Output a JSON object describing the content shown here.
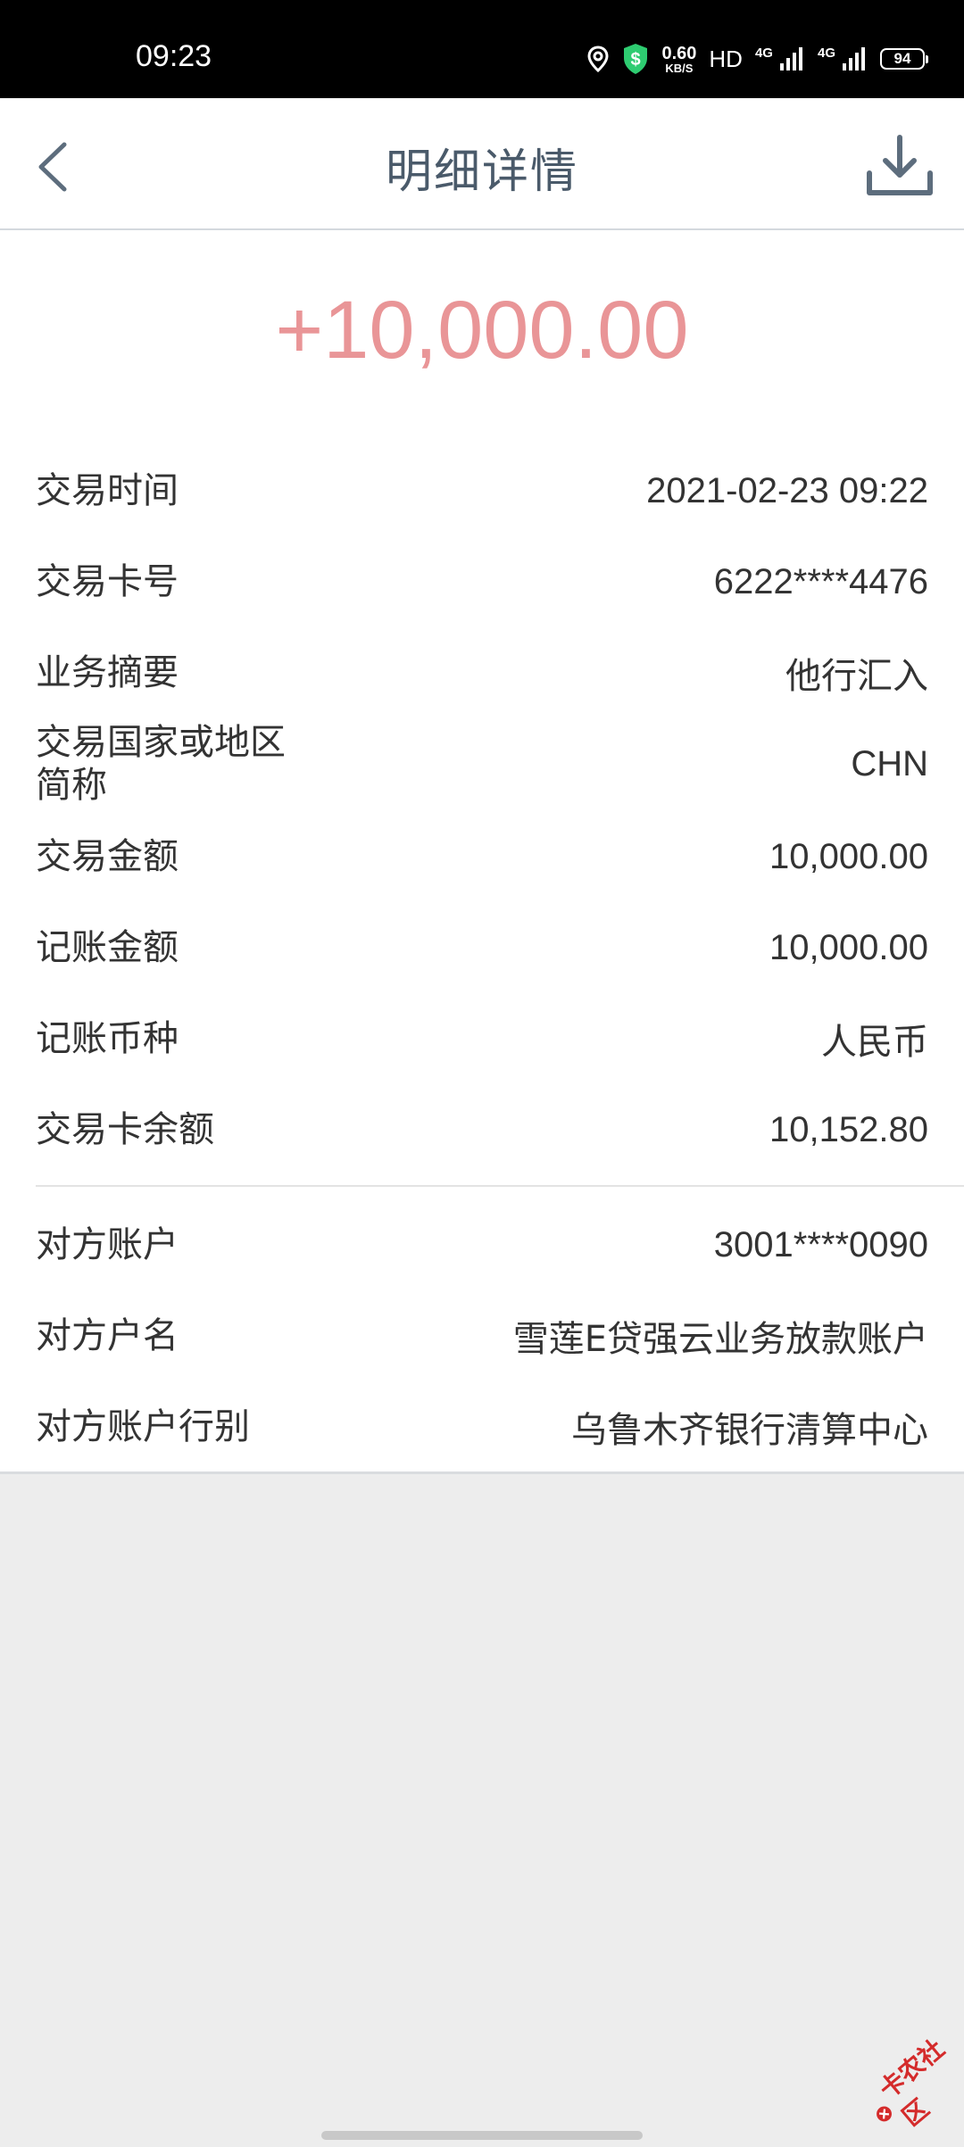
{
  "status_bar": {
    "time": "09:23",
    "net_speed": "0.60",
    "net_speed_unit": "KB/S",
    "hd_label": "HD",
    "signal1_label": "4G",
    "signal2_label": "4G",
    "battery": "94"
  },
  "header": {
    "title": "明细详情",
    "back_icon": "chevron-left-icon",
    "download_icon": "download-icon"
  },
  "amount": "+10,000.00",
  "details": [
    {
      "label": "交易时间",
      "value": "2021-02-23 09:22"
    },
    {
      "label": "交易卡号",
      "value": "6222****4476"
    },
    {
      "label": "业务摘要",
      "value": "他行汇入"
    },
    {
      "label": "交易国家或地区\n简称",
      "value": "CHN"
    },
    {
      "label": "交易金额",
      "value": "10,000.00"
    },
    {
      "label": "记账金额",
      "value": "10,000.00"
    },
    {
      "label": "记账币种",
      "value": "人民币"
    },
    {
      "label": "交易卡余额",
      "value": "10,152.80"
    }
  ],
  "counterparty": [
    {
      "label": "对方账户",
      "value": "3001****0090"
    },
    {
      "label": "对方户名",
      "value": "雪莲E贷强云业务放款账户"
    },
    {
      "label": "对方账户行别",
      "value": "乌鲁木齐银行清算中心"
    }
  ],
  "watermark": "卡农社区",
  "colors": {
    "amount": "#e99597",
    "title": "#4a5a6a",
    "background": "#ededed"
  }
}
